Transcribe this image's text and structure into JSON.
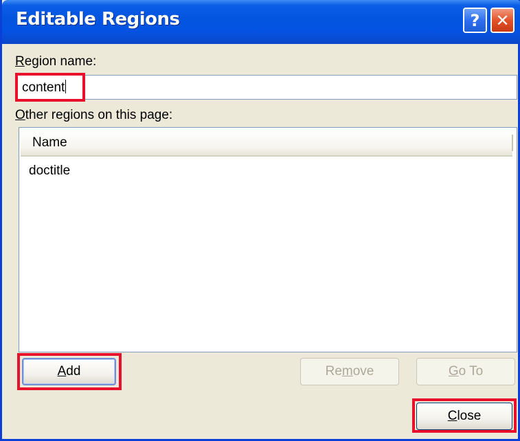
{
  "window": {
    "title": "Editable Regions",
    "help_glyph": "?",
    "close_glyph": "✕"
  },
  "region_name": {
    "label_mnemonic": "R",
    "label_rest": "egion name:",
    "value": "content"
  },
  "other_regions": {
    "label_mnemonic": "O",
    "label_rest": "ther regions on this page:",
    "column_header": "Name",
    "rows": [
      "doctitle"
    ]
  },
  "buttons": {
    "add": {
      "mnemonic": "A",
      "rest": "dd"
    },
    "remove": {
      "pre": "Re",
      "mnemonic": "m",
      "rest": "ove"
    },
    "goto": {
      "mnemonic": "G",
      "rest": "o To"
    },
    "close": {
      "mnemonic": "C",
      "rest": "lose"
    }
  },
  "colors": {
    "titlebar": "#0355e0",
    "dialog_bg": "#ece9d8",
    "highlight": "#e8102a"
  }
}
